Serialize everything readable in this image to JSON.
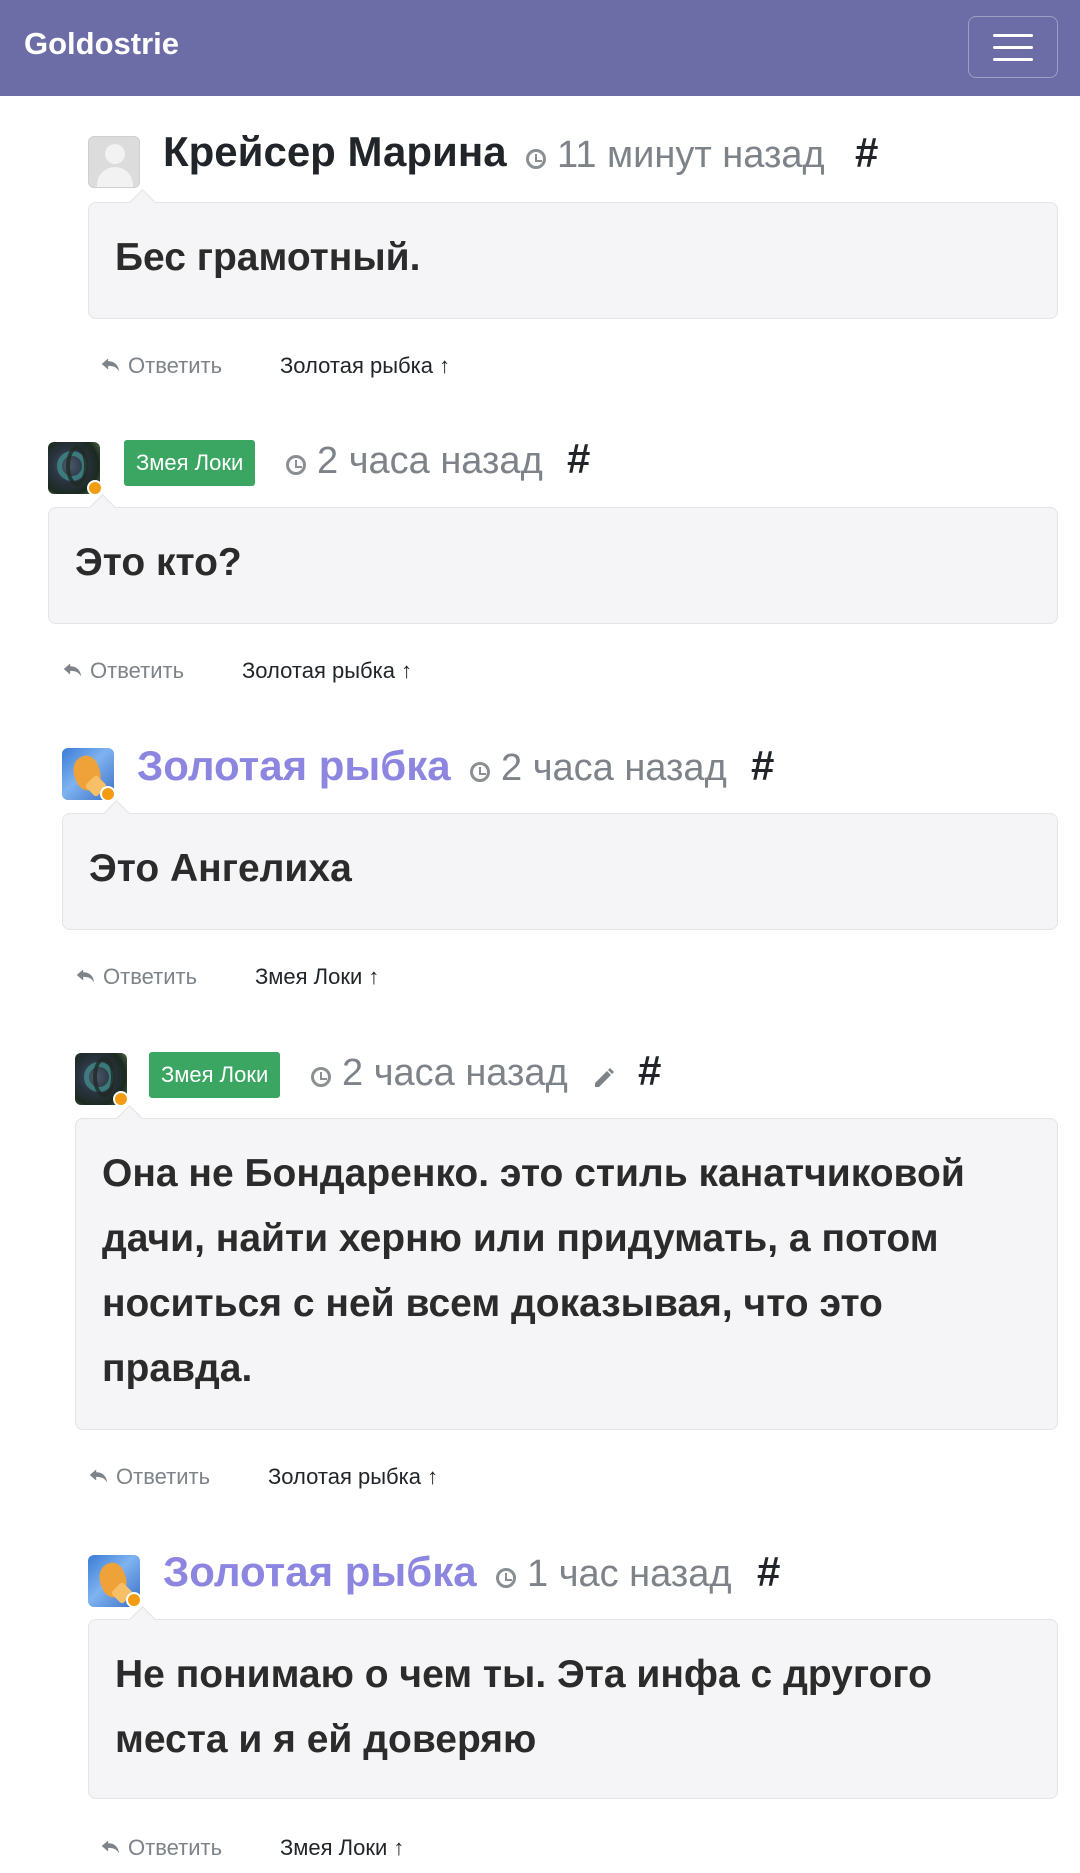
{
  "app": {
    "brand": "Goldostrie",
    "menu_icon": "hamburger-menu-icon"
  },
  "comments": [
    {
      "author": "Крейсер Марина",
      "author_style": "plain",
      "avatar": "default-user-icon",
      "time": "11 минут назад",
      "permalink": "#",
      "text": "Бес грамотный.",
      "reply_label": "Ответить",
      "parent": "Золотая рыбка ↑"
    },
    {
      "author": "Змея Локи",
      "author_style": "badge",
      "avatar": "snake-avatar",
      "time": "2 часа назад",
      "permalink": "#",
      "text": "Это кто?",
      "reply_label": "Ответить",
      "parent": "Золотая рыбка ↑"
    },
    {
      "author": "Золотая рыбка",
      "author_style": "link",
      "avatar": "goldfish-avatar",
      "time": "2 часа назад",
      "permalink": "#",
      "text": "Это Ангелиха",
      "reply_label": "Ответить",
      "parent": "Змея Локи ↑"
    },
    {
      "author": "Змея Локи",
      "author_style": "badge",
      "avatar": "snake-avatar",
      "time": "2 часа назад",
      "edited": true,
      "permalink": "#",
      "text": "Она не Бондаренко. это стиль канатчиковой дачи, найти херню или придумать, а потом носиться с ней всем доказывая, что это правда.",
      "reply_label": "Ответить",
      "parent": "Золотая рыбка ↑"
    },
    {
      "author": "Золотая рыбка",
      "author_style": "link",
      "avatar": "goldfish-avatar",
      "time": "1 час назад",
      "permalink": "#",
      "text": "Не понимаю о чем ты. Эта инфа с другого места и я ей доверяю",
      "reply_label": "Ответить",
      "parent": "Змея Локи ↑"
    }
  ],
  "colors": {
    "navbar": "#6c6ca6",
    "badge": "#3aa661",
    "author_link": "#8c86e0",
    "online_dot": "#f39c12"
  }
}
